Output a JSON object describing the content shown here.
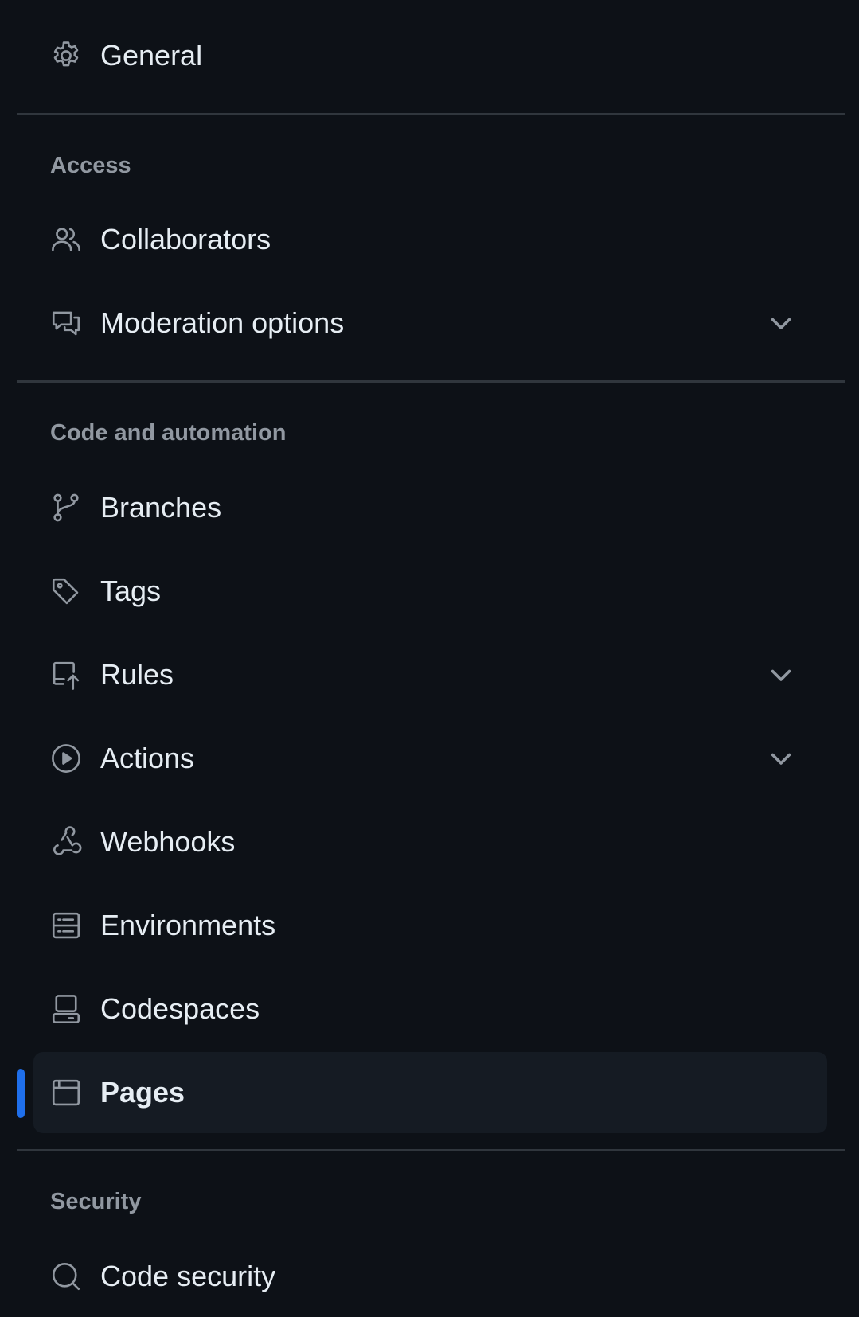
{
  "nav": {
    "general": {
      "label": "General",
      "icon": "gear-icon"
    },
    "sections": {
      "access": {
        "heading": "Access",
        "items": [
          {
            "label": "Collaborators",
            "icon": "people-icon"
          },
          {
            "label": "Moderation options",
            "icon": "comment-discussion-icon",
            "expandable": true
          }
        ]
      },
      "code_and_automation": {
        "heading": "Code and automation",
        "items": [
          {
            "label": "Branches",
            "icon": "git-branch-icon"
          },
          {
            "label": "Tags",
            "icon": "tag-icon"
          },
          {
            "label": "Rules",
            "icon": "repo-push-icon",
            "expandable": true
          },
          {
            "label": "Actions",
            "icon": "play-icon",
            "expandable": true
          },
          {
            "label": "Webhooks",
            "icon": "webhook-icon"
          },
          {
            "label": "Environments",
            "icon": "server-icon"
          },
          {
            "label": "Codespaces",
            "icon": "codespaces-icon"
          },
          {
            "label": "Pages",
            "icon": "browser-icon",
            "active": true
          }
        ]
      },
      "security": {
        "heading": "Security",
        "items": [
          {
            "label": "Code security",
            "icon": "codescan-icon",
            "partially_visible": true
          }
        ]
      }
    }
  },
  "colors": {
    "background": "#0d1117",
    "active_background": "#151b23",
    "accent": "#1f6feb",
    "divider": "#30363d",
    "muted_text": "#9198a1",
    "text": "#e6edf3"
  }
}
